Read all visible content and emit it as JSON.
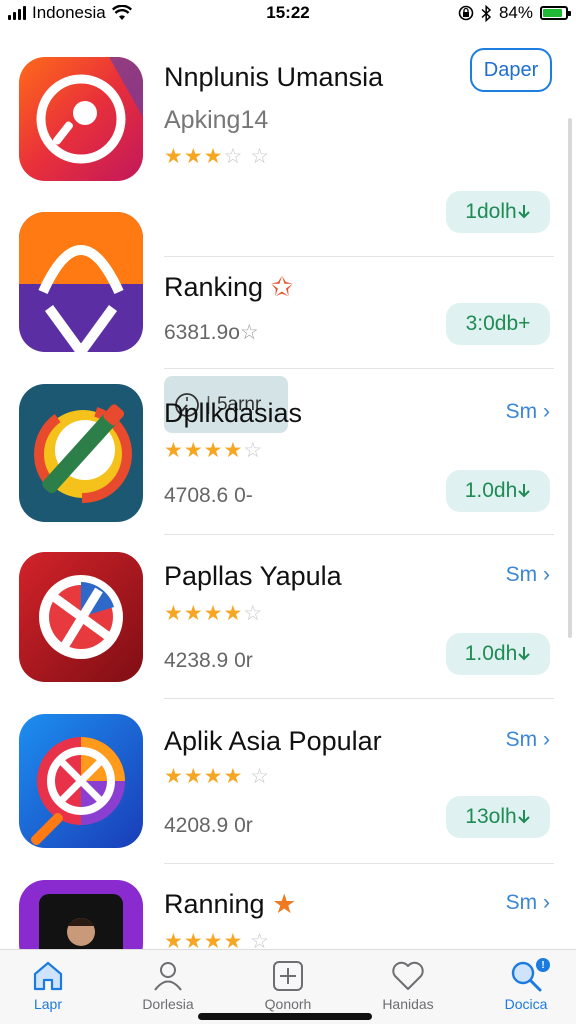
{
  "status_bar": {
    "carrier": "Indonesia",
    "time": "15:22",
    "battery": "84%"
  },
  "apps": [
    {
      "title": "Nnplunis Umansia",
      "subtitle": "Apking14",
      "stars": 3,
      "action": "Daper"
    },
    {
      "badge_text": "5arnr",
      "pill": "1dolh"
    },
    {
      "title": "Ranking",
      "meta": "6381.9o",
      "pill": "3:0db+"
    },
    {
      "title": "Dpllkdasias",
      "stars": 4,
      "meta": "4708.6 0-",
      "more": "Sm",
      "pill": "1.0dh"
    },
    {
      "title": "Papllas Yapula",
      "stars": 4,
      "meta": "4238.9 0r",
      "more": "Sm",
      "pill": "1.0dh"
    },
    {
      "title": "Aplik Asia Popular",
      "stars": 4,
      "meta": "4208.9 0r",
      "more": "Sm",
      "pill": "13olh"
    },
    {
      "title": "Ranning",
      "stars": 4,
      "more": "Sm"
    }
  ],
  "tabs": [
    {
      "label": "Lapr",
      "icon": "home-icon",
      "active": true
    },
    {
      "label": "Dorlesia",
      "icon": "person-icon",
      "active": false
    },
    {
      "label": "Qonorh",
      "icon": "add-square-icon",
      "active": false
    },
    {
      "label": "Hanidas",
      "icon": "heart-icon",
      "active": false
    },
    {
      "label": "Docica",
      "icon": "search-icon",
      "active": true
    }
  ],
  "colors": {
    "accent": "#1b7be0",
    "pill_bg": "#dff1f0",
    "pill_text": "#1f8b55",
    "star": "#f5a623"
  }
}
